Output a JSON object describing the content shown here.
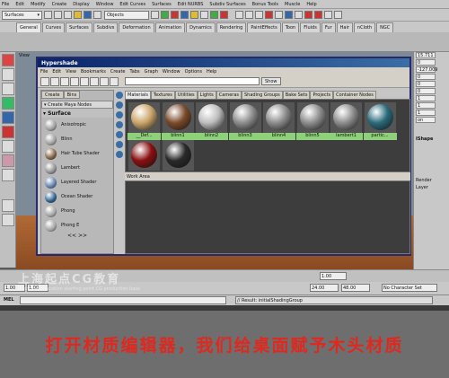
{
  "main_menu": [
    "File",
    "Edit",
    "Modify",
    "Create",
    "Display",
    "Window",
    "Edit Curves",
    "Surfaces",
    "Edit NURBS",
    "Subdiv Surfaces",
    "Bonus Tools",
    "Muscle",
    "Help"
  ],
  "status_line": {
    "menu_set": "Surfaces",
    "selection_mode": "Objects"
  },
  "shelf_tabs": [
    "General",
    "Curves",
    "Surfaces",
    "Subdivs",
    "Deformation",
    "Animation",
    "Dynamics",
    "Rendering",
    "PaintEffects",
    "Toon",
    "Fluids",
    "Fur",
    "Hair",
    "nCloth",
    "NGC"
  ],
  "shelf_active_tab": "General",
  "viewport": {
    "menu_label": "View"
  },
  "channel_box": {
    "values": [
      "15.711",
      "0",
      "-127.009",
      "0",
      "0",
      "0",
      "1",
      "1",
      "1",
      "on"
    ],
    "shape_label": "IShape",
    "render_label": "Render",
    "layer_label": "Layer"
  },
  "hypershade": {
    "title": "Hypershade",
    "menu": [
      "File",
      "Edit",
      "View",
      "Bookmarks",
      "Create",
      "Tabs",
      "Graph",
      "Window",
      "Options",
      "Help"
    ],
    "show_button": "Show",
    "left_tabs": [
      "Create",
      "Bins"
    ],
    "create_header": "Create Maya Nodes",
    "category": "Surface",
    "nodes": [
      {
        "label": "Anisotropic",
        "color": "#9a9a9a"
      },
      {
        "label": "Blinn",
        "color": "#9a9a9a"
      },
      {
        "label": "Hair Tube Shader",
        "color": "#7a5c3c"
      },
      {
        "label": "Lambert",
        "color": "#8a8a8a"
      },
      {
        "label": "Layered Shader",
        "color": "#5a7aa8"
      },
      {
        "label": "Ocean Shader",
        "color": "#2a5a8a"
      },
      {
        "label": "Phong",
        "color": "#a0a0a0"
      },
      {
        "label": "Phong E",
        "color": "#a0a0a0"
      }
    ],
    "left_nav": "<< >>",
    "right_tabs": [
      "Materials",
      "Textures",
      "Utilities",
      "Lights",
      "Cameras",
      "Shading Groups",
      "Bake Sets",
      "Projects",
      "Container Nodes"
    ],
    "right_active_tab": "Materials",
    "materials": [
      {
        "label": "__Def...",
        "color": "#caa56a"
      },
      {
        "label": "blinn1",
        "color": "#7a4a2a"
      },
      {
        "label": "blinn2",
        "color": "#bdbdbd"
      },
      {
        "label": "blinn3",
        "color": "#8c8c8c"
      },
      {
        "label": "blinn4",
        "color": "#8c8c8c"
      },
      {
        "label": "blinn5",
        "color": "#8c8c8c"
      },
      {
        "label": "lambert1",
        "color": "#8c8c8c"
      },
      {
        "label": "partic...",
        "color": "#2a6a7a"
      },
      {
        "label": "",
        "color": "#8a1010"
      },
      {
        "label": "",
        "color": "#2a2a2a"
      }
    ],
    "work_area_label": "Work Area"
  },
  "time_range": {
    "start": "1.00",
    "current": "1.00",
    "end": "24.00",
    "total": "48.00",
    "character_set": "No Character Set"
  },
  "command_line": {
    "label": "MEL",
    "result": "// Result: initialShadingGroup"
  },
  "frame_field": "1.00",
  "watermark": {
    "main": "上海起点CG教育",
    "sub": "Shanghai education starting point CG production base"
  },
  "subtitle": "打开材质编辑器，我们给桌面赋予木头材质"
}
